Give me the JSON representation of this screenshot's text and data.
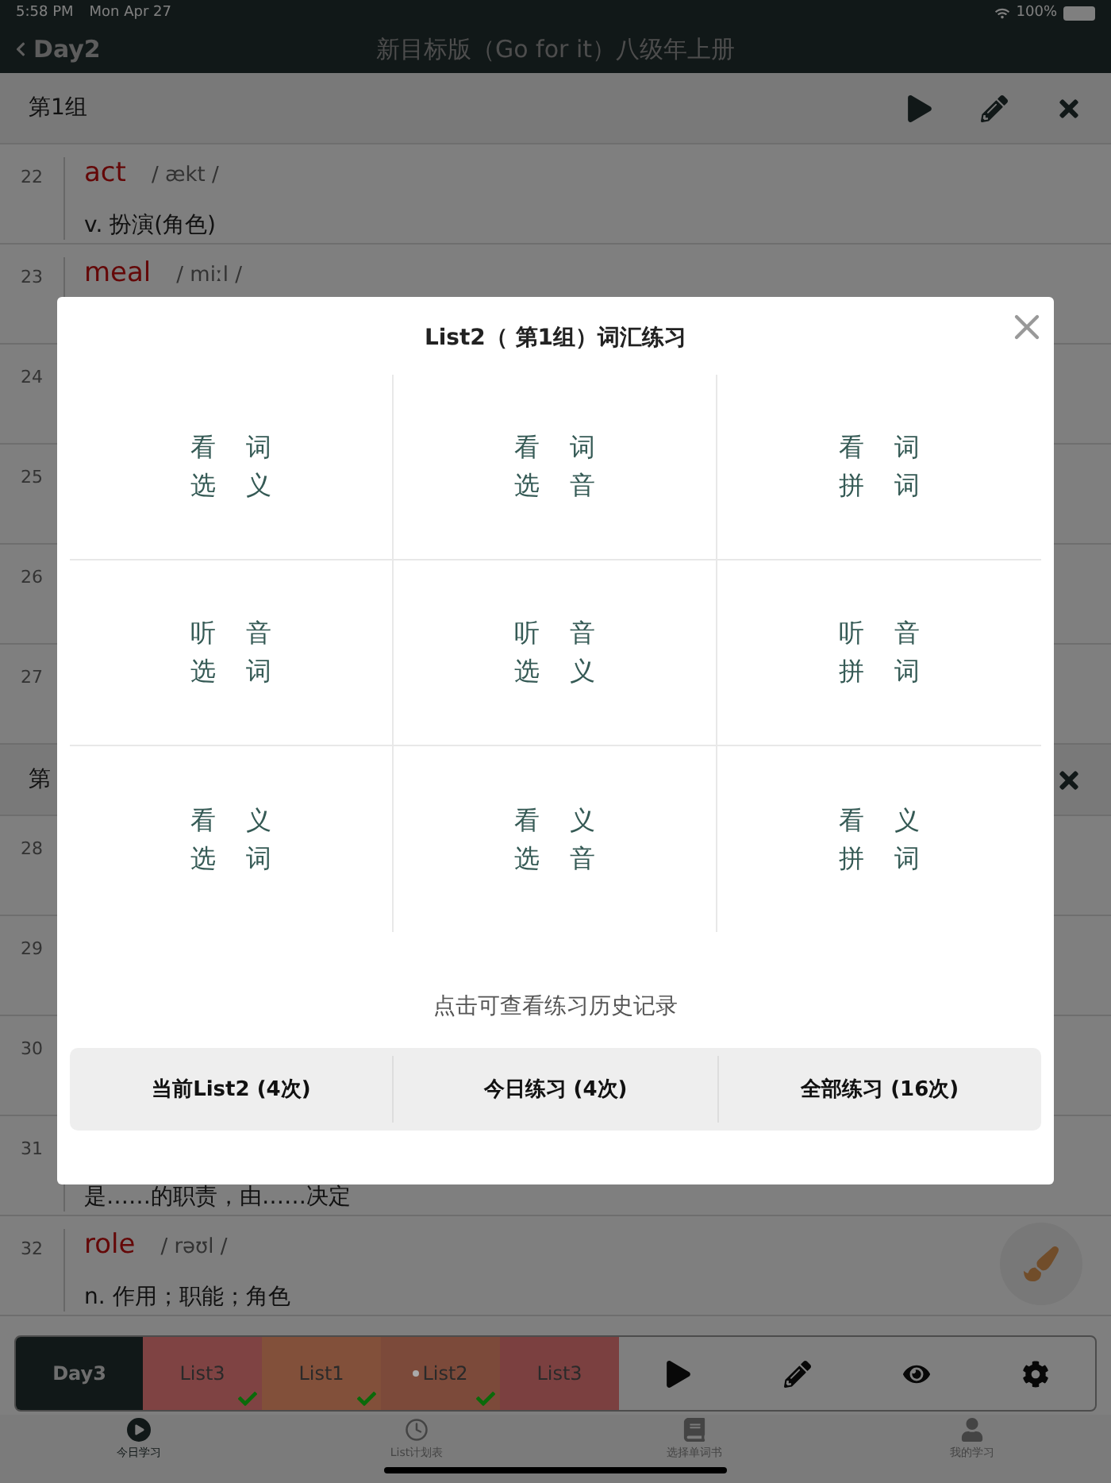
{
  "status_bar": {
    "time": "5:58 PM",
    "date": "Mon Apr 27",
    "battery": "100%"
  },
  "nav": {
    "back": "Day2",
    "title": "新目标版（Go for it）八级年上册"
  },
  "groups": [
    {
      "title": "第1组",
      "actions": [
        {
          "kind": "play"
        },
        {
          "kind": "edit"
        },
        {
          "kind": "close"
        }
      ],
      "words": [
        {
          "number": "22",
          "word": "act",
          "phonetic": "/ ækt /",
          "meaning": "v. 扮演(角色)"
        },
        {
          "number": "23",
          "word": "meal",
          "phonetic": "/ miːl /"
        },
        {
          "number": "24"
        },
        {
          "number": "25"
        },
        {
          "number": "26"
        },
        {
          "number": "27"
        }
      ]
    },
    {
      "title": "第",
      "actions": [
        {
          "kind": "close"
        }
      ],
      "words": [
        {
          "number": "28"
        },
        {
          "number": "29"
        },
        {
          "number": "30"
        },
        {
          "number": "31",
          "meaning": "是……的职责，由……决定"
        },
        {
          "number": "32",
          "word": "role",
          "phonetic": "/ rəʊl /",
          "meaning": "n. 作用；职能；角色"
        }
      ]
    }
  ],
  "list_bar": {
    "day": "Day3",
    "lists": [
      {
        "label": "List3",
        "color": "#7f4343",
        "done": true,
        "current": false
      },
      {
        "label": "List1",
        "color": "#82503a",
        "done": true,
        "current": false
      },
      {
        "label": "List2",
        "color": "#7c4a3a",
        "done": true,
        "current": true
      },
      {
        "label": "List3",
        "color": "#7b4040",
        "done": false,
        "current": false
      }
    ]
  },
  "tab_bar": [
    {
      "label": "今日学习",
      "selected": true
    },
    {
      "label": "List计划表",
      "selected": false
    },
    {
      "label": "选择单词书",
      "selected": false
    },
    {
      "label": "我的学习",
      "selected": false
    }
  ],
  "modal": {
    "title": "List2（ 第1组）词汇练习",
    "exercises": [
      [
        "看 词",
        "选 义"
      ],
      [
        "看 词",
        "选 音"
      ],
      [
        "看 词",
        "拼 词"
      ],
      [
        "听 音",
        "选 词"
      ],
      [
        "听 音",
        "选 义"
      ],
      [
        "听 音",
        "拼 词"
      ],
      [
        "看 义",
        "选 词"
      ],
      [
        "看 义",
        "选 音"
      ],
      [
        "看 义",
        "拼 词"
      ]
    ],
    "hint": "点击可查看练习历史记录",
    "history": [
      "当前List2 (4次)",
      "今日练习 (4次)",
      "全部练习 (16次)"
    ]
  }
}
